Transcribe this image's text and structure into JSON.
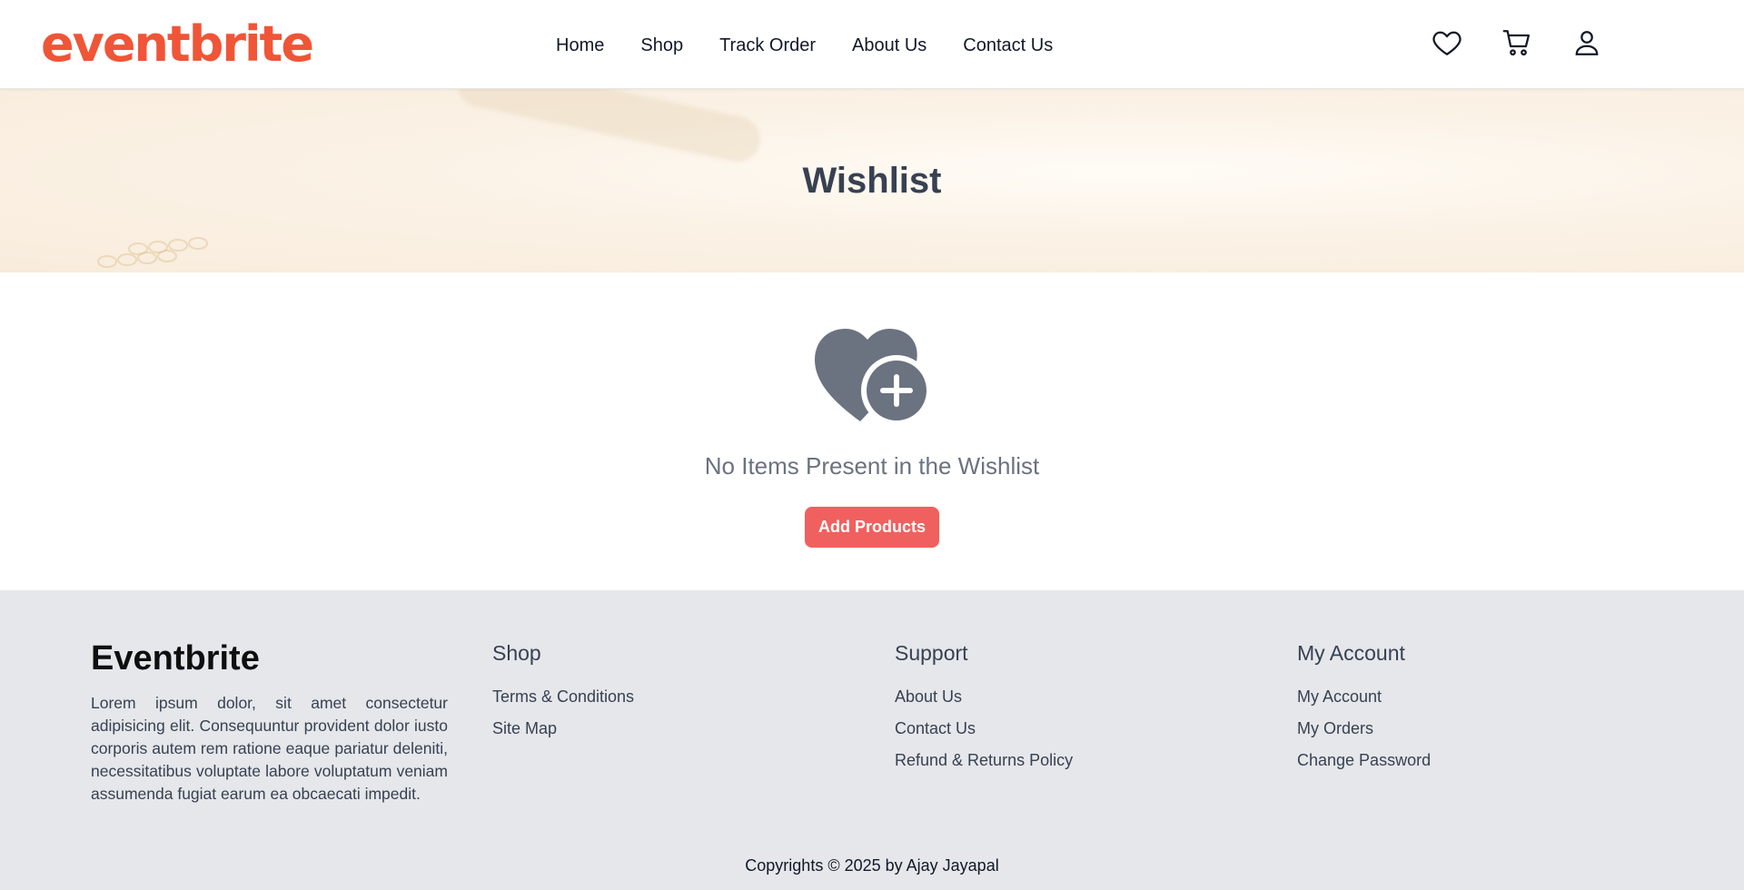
{
  "header": {
    "logo": "eventbrite",
    "nav": [
      {
        "label": "Home"
      },
      {
        "label": "Shop"
      },
      {
        "label": "Track Order"
      },
      {
        "label": "About Us"
      },
      {
        "label": "Contact Us"
      }
    ],
    "icons": [
      "heart-icon",
      "cart-icon",
      "user-icon"
    ]
  },
  "hero": {
    "title": "Wishlist"
  },
  "empty_state": {
    "icon": "heart-plus-icon",
    "message": "No Items Present in the Wishlist",
    "button_label": "Add Products"
  },
  "footer": {
    "brand": {
      "title": "Eventbrite",
      "description": "Lorem ipsum dolor, sit amet consectetur adipisicing elit. Consequuntur provident dolor iusto corporis autem rem ratione eaque pariatur deleniti, necessitatibus voluptate labore voluptatum veniam assumenda fugiat earum ea obcaecati impedit."
    },
    "columns": [
      {
        "title": "Shop",
        "links": [
          "Terms & Conditions",
          "Site Map"
        ]
      },
      {
        "title": "Support",
        "links": [
          "About Us",
          "Contact Us",
          "Refund & Returns Policy"
        ]
      },
      {
        "title": "My Account",
        "links": [
          "My Account",
          "My Orders",
          "Change Password"
        ]
      }
    ],
    "copyright": "Copyrights © 2025 by Ajay Jayapal"
  },
  "colors": {
    "brand": "#f05537",
    "button": "#f0605f",
    "footer_bg": "#e5e7eb",
    "icon_gray": "#6b7280"
  }
}
